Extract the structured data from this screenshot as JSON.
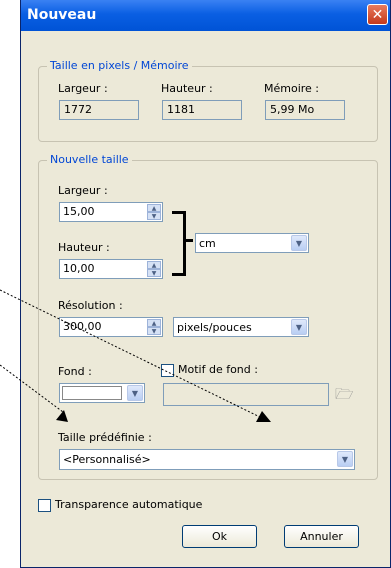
{
  "window": {
    "title": "Nouveau",
    "close_glyph": "✕"
  },
  "pixel_group": {
    "legend": "Taille en pixels / Mémoire",
    "width_label": "Largeur :",
    "width_value": "1772",
    "height_label": "Hauteur :",
    "height_value": "1181",
    "memory_label": "Mémoire :",
    "memory_value": "5,99 Mo"
  },
  "new_size_group": {
    "legend": "Nouvelle taille",
    "width_label": "Largeur :",
    "width_value": "15,00",
    "height_label": "Hauteur :",
    "height_value": "10,00",
    "unit_value": "cm",
    "resolution_label": "Résolution :",
    "resolution_value": "300,00",
    "resolution_unit": "pixels/pouces",
    "background_label": "Fond :",
    "pattern_label": "Motif de fond :",
    "preset_label": "Taille prédéfinie :",
    "preset_value": "<Personnalisé>"
  },
  "auto_transparency_label": "Transparence automatique",
  "buttons": {
    "ok": "Ok",
    "cancel": "Annuler"
  },
  "icons": {
    "spin_up": "▲",
    "spin_down": "▼",
    "dropdown": "▼",
    "folder": "🗁"
  }
}
